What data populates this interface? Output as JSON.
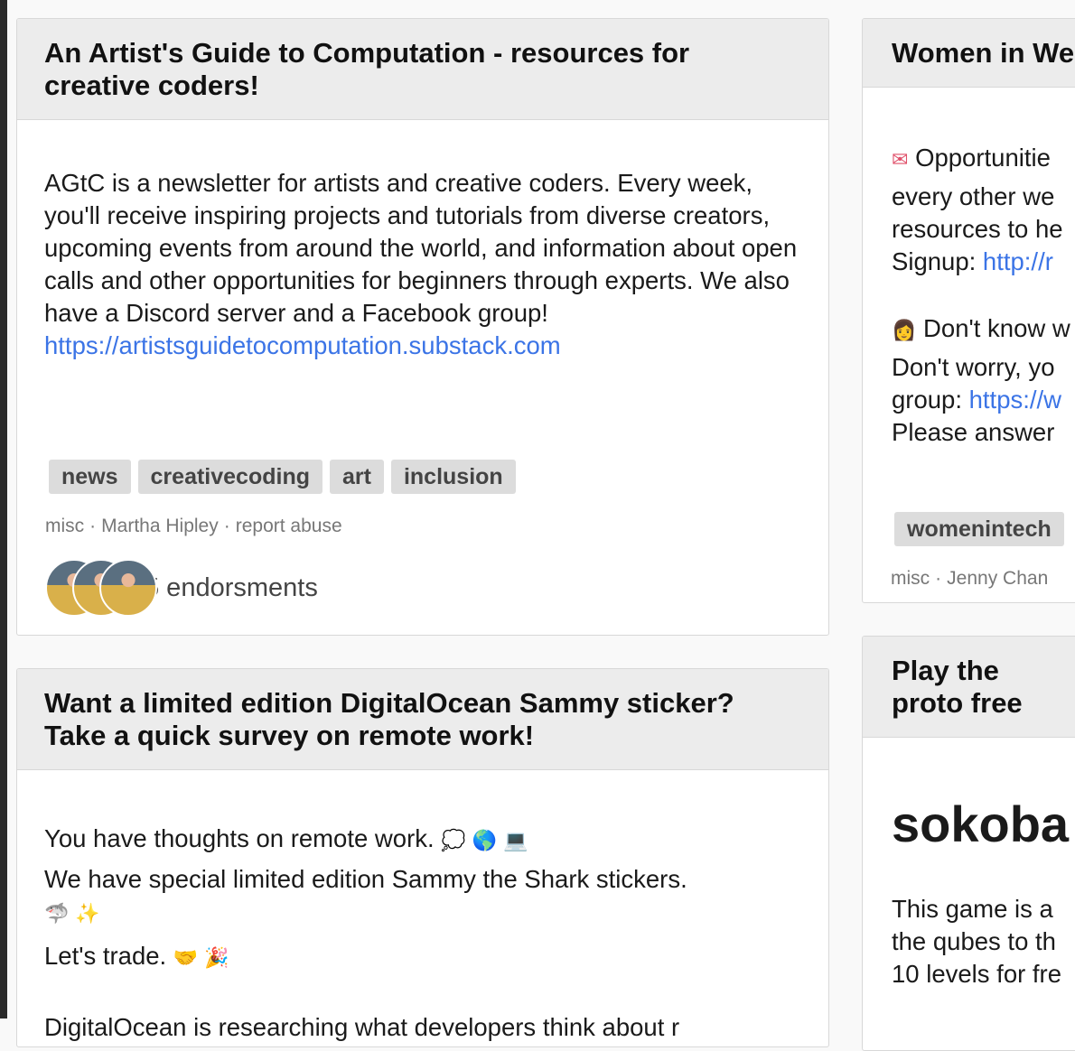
{
  "cards": {
    "artist_guide": {
      "title": "An Artist's Guide to Computation - resources for creative coders!",
      "description": "AGtC is a newsletter for artists and creative coders. Every week, you'll receive inspiring projects and tutorials from diverse creators, upcoming events from around the world, and information about open calls and other opportunities for beginners through experts. We also have a Discord server and a Facebook group!",
      "link": "https://artistsguidetocomputation.substack.com",
      "tags": [
        "news",
        "creativecoding",
        "art",
        "inclusion"
      ],
      "category": "misc",
      "author": "Martha Hipley",
      "report": "report abuse",
      "endorsements": "5 endorsments"
    },
    "women_in": {
      "title": "Women in We",
      "line1": "Opportunitie",
      "line2": "every other we",
      "line3": "resources to he",
      "line4_text": "Signup: ",
      "line4_link": "http://r",
      "line5": "Don't know w",
      "line6": "Don't worry, yo",
      "line7_text": "group: ",
      "line7_link": "https://w",
      "line8": "Please answer",
      "tag": "womenintech",
      "category": "misc",
      "author": "Jenny Chan"
    },
    "sammy": {
      "title": "Want a limited edition DigitalOcean Sammy sticker? Take a quick survey on remote work!",
      "line1": "You have thoughts on remote work.",
      "line1_emoji": "💭 🌎 💻",
      "line2": "We have special limited edition Sammy the Shark stickers.",
      "line3_emoji": "🦈 ✨",
      "line4": "Let's trade.",
      "line4_emoji": "🤝 🎉",
      "line5": "DigitalOcean is researching what developers think about r"
    },
    "sokoban": {
      "title": "Play the proto free",
      "heading": "sokoba",
      "line1": "This game is a",
      "line2": "the qubes to th",
      "line3": "10 levels for fre"
    }
  }
}
